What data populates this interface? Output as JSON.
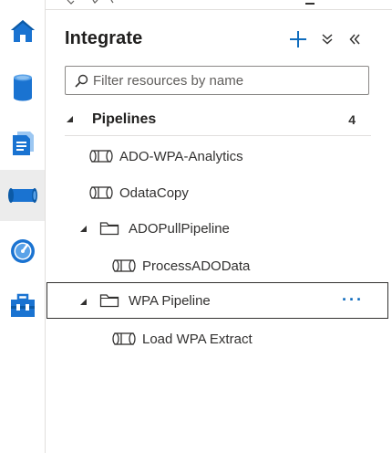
{
  "rail": {
    "items": [
      {
        "name": "home",
        "icon": "home-icon"
      },
      {
        "name": "data",
        "icon": "database-icon"
      },
      {
        "name": "develop",
        "icon": "document-icon"
      },
      {
        "name": "integrate",
        "icon": "pipeline-icon",
        "active": true
      },
      {
        "name": "monitor",
        "icon": "gauge-icon"
      },
      {
        "name": "manage",
        "icon": "toolbox-icon"
      }
    ]
  },
  "panel": {
    "title": "Integrate",
    "add_icon": "plus-icon",
    "collapse_all_icon": "double-chevron-down-icon",
    "hide_panel_icon": "double-chevron-left-icon",
    "search": {
      "placeholder": "Filter resources by name",
      "value": ""
    }
  },
  "tree": {
    "section": {
      "label": "Pipelines",
      "count": "4"
    },
    "items": [
      {
        "label": "ADO-WPA-Analytics",
        "type": "pipeline"
      },
      {
        "label": "OdataCopy",
        "type": "pipeline"
      },
      {
        "label": "ADOPullPipeline",
        "type": "folder"
      },
      {
        "label": "ProcessADOData",
        "type": "pipeline"
      },
      {
        "label": "WPA Pipeline",
        "type": "folder",
        "selected": true,
        "more": "···"
      },
      {
        "label": "Load WPA Extract",
        "type": "pipeline"
      }
    ]
  },
  "colors": {
    "accent": "#0f6cbd",
    "brand_blue": "#1a73d1",
    "text": "#323130",
    "border": "#8a8886"
  }
}
